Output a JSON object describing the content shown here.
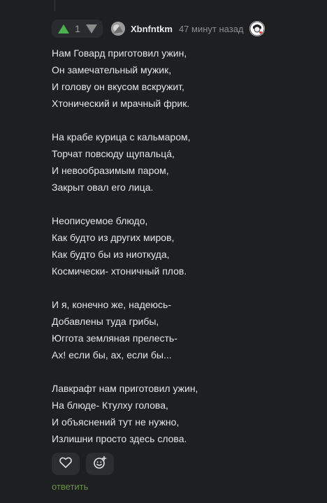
{
  "comment": {
    "rating": "1",
    "author": "Xbnfntkm",
    "time_ago": "47 минут назад",
    "icons": {
      "upvote": "upvote-arrow-icon",
      "downvote": "downvote-arrow-icon",
      "like": "heart-icon",
      "react": "emoji-add-icon"
    },
    "colors": {
      "upvote": "#4caf50",
      "downvote": "#8a8a8a",
      "reply": "#6b8f45",
      "background": "#1e1f21"
    },
    "stanzas": [
      {
        "lines": [
          "Нам Говард приготовил ужин,",
          "Он замечательный мужик,",
          "И голову он вкусом вскружит,",
          "Хтонический и мрачный фрик."
        ]
      },
      {
        "lines": [
          "На крабе курица с кальмаром,",
          "Торчат повсюду щупальцá,",
          "И невообразимым паром,",
          "Закрыт овал его лица."
        ]
      },
      {
        "lines": [
          "Неописуемое блюдо,",
          "Как будто из других миров,",
          "Как будто бы из ниоткуда,",
          "Космически- хтоничный плов."
        ]
      },
      {
        "lines": [
          "И я, конечно же, надеюсь-",
          "Добавлены туда грибы,",
          "Юггота земляная прелесть-",
          "Ах! если бы, ах, если бы..."
        ]
      },
      {
        "lines": [
          "Лавкрафт нам приготовил ужин,",
          "На блюде- Ктулху голова,",
          "И объяснений тут не нужно,",
          "Излишни просто здесь слова."
        ]
      }
    ],
    "reply_label": "ответить"
  }
}
